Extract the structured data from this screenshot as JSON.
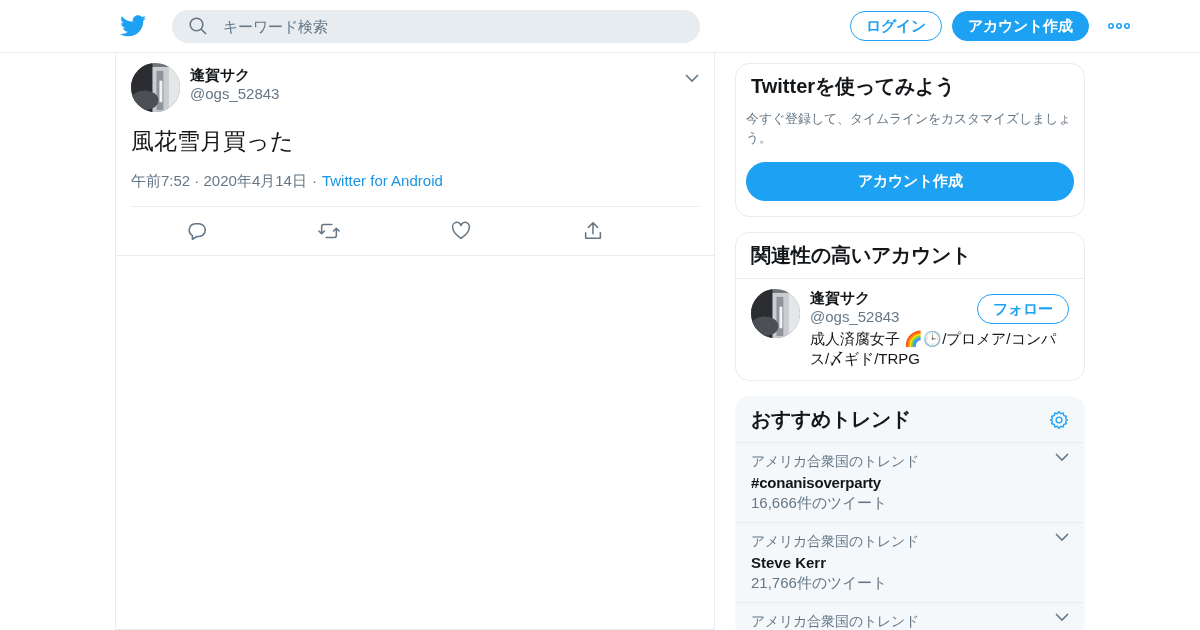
{
  "header": {
    "search": {
      "placeholder": "キーワード検索"
    },
    "login_button": "ログイン",
    "signup_button": "アカウント作成"
  },
  "tweet": {
    "name": "逢賀サク",
    "handle": "@ogs_52843",
    "text": "風花雪月買った",
    "time": "午前7:52 · 2020年4月14日",
    "separator": "·",
    "source": "Twitter for Android"
  },
  "signup_card": {
    "title": "Twitterを使ってみよう",
    "text": "今すぐ登録して、タイムラインをカスタマイズしましょう。",
    "button": "アカウント作成"
  },
  "related_card": {
    "title": "関連性の高いアカウント",
    "account": {
      "name": "逢賀サク",
      "handle": "@ogs_52843",
      "follow_button": "フォロー",
      "bio": "成人済腐女子 🌈🕒/プロメア/コンパス/〆ギド/TRPG"
    }
  },
  "trends_card": {
    "title": "おすすめトレンド",
    "trends": [
      {
        "context": "アメリカ合衆国のトレンド",
        "name": "#conanisoverparty",
        "count": "16,666件のツイート",
        "kind": "hashtag"
      },
      {
        "context": "アメリカ合衆国のトレンド",
        "name": "Steve Kerr",
        "count": "21,766件のツイート",
        "kind": "topic"
      },
      {
        "context": "アメリカ合衆国のトレンド",
        "kind": "partial"
      }
    ]
  }
}
